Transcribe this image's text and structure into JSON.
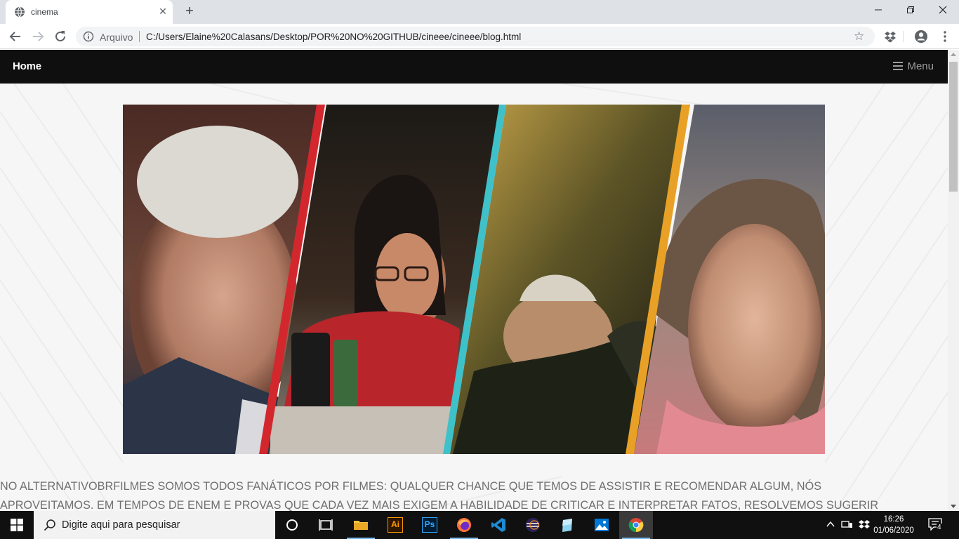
{
  "browser": {
    "tab_title": "cinema",
    "new_tab": "+",
    "close_tab": "✕",
    "window": {
      "minimize": "—",
      "restore": "❐",
      "close": "✕"
    },
    "omnibox": {
      "scheme_label": "Arquivo",
      "url": "C:/Users/Elaine%20Calasans/Desktop/POR%20NO%20GITHUB/cineee/cineee/blog.html"
    },
    "icons": [
      "back-icon",
      "forward-icon",
      "reload-icon",
      "info-icon",
      "star-icon",
      "dropbox-icon",
      "account-icon",
      "more-icon"
    ]
  },
  "page": {
    "brand": "Home",
    "menu_label": "Menu",
    "hero_description": "Collage of four film stills separated by red, teal and orange diagonal stripes",
    "intro_lines": [
      "NO ALTERNATIVOBRFILMES SOMOS TODOS FANÁTICOS POR FILMES: QUALQUER CHANCE QUE TEMOS DE ASSISTIR E RECOMENDAR ALGUM, NÓS",
      "APROVEITAMOS. EM TEMPOS DE ENEM E PROVAS QUE CADA VEZ MAIS EXIGEM A HABILIDADE DE CRITICAR E INTERPRETAR FATOS, RESOLVEMOS SUGERIR"
    ]
  },
  "taskbar": {
    "search_placeholder": "Digite aqui para pesquisar",
    "apps": [
      "task-view",
      "file-explorer",
      "illustrator",
      "photoshop",
      "firefox",
      "vscode",
      "eclipse",
      "app-blue",
      "photos",
      "chrome"
    ],
    "illustrator_label": "Ai",
    "photoshop_label": "Ps",
    "time": "16:26",
    "date": "01/06/2020",
    "notifications_count": "4"
  },
  "colors": {
    "navbar": "#0f0f0f",
    "stripe_red": "#d3272e",
    "stripe_teal": "#3fc1c9",
    "stripe_orange": "#e8a126",
    "text": "#6f6f6f"
  }
}
